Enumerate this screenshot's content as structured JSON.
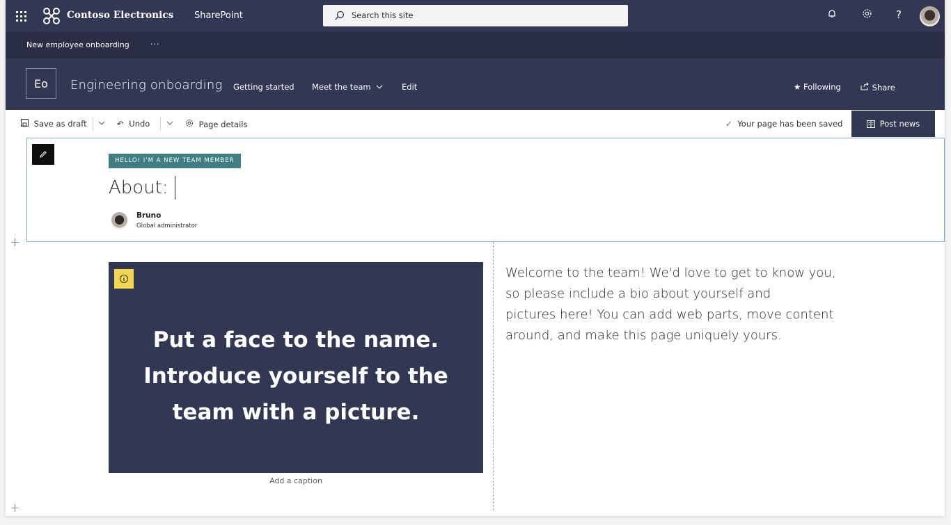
{
  "suite_bar": {
    "org_name": "Contoso Electronics",
    "app_name": "SharePoint",
    "search_placeholder": "Search this site",
    "icons": [
      "waffle-icon",
      "bell-icon",
      "gear-icon",
      "help-icon",
      "avatar"
    ]
  },
  "hub_bar": {
    "site_link": "New employee onboarding",
    "more": "···"
  },
  "site_header": {
    "logo_initials": "Eo",
    "title": "Engineering onboarding",
    "nav": [
      "Getting started",
      "Meet the team",
      "Edit"
    ],
    "following_label": "Following",
    "share_label": "Share"
  },
  "command_bar": {
    "save_draft": "Save as draft",
    "undo": "Undo",
    "page_details": "Page details",
    "saved_status": "Your page has been saved",
    "post_news": "Post news"
  },
  "title_region": {
    "topic_tag": "HELLO! I'M A NEW TEAM MEMBER",
    "title": "About:",
    "author_name": "Bruno",
    "author_role": "Global administrator"
  },
  "image_webpart": {
    "lines": [
      "Put a face to the name.",
      "Introduce yourself to the",
      "team with a picture."
    ],
    "caption_placeholder": "Add a caption"
  },
  "text_webpart": {
    "lines": [
      "Welcome to the team! We'd love to get to know you,",
      "so please include a bio about yourself and",
      "pictures here! You can add web parts, move content",
      "around, and make this page uniquely yours."
    ]
  },
  "colors": {
    "suite_bar_bg": "#323853",
    "hub_bar_bg": "#2a2f45",
    "topic_tag_bg": "#3f7e83",
    "info_badge": "#f4d64e",
    "selection_border": "#7fa8e0"
  }
}
